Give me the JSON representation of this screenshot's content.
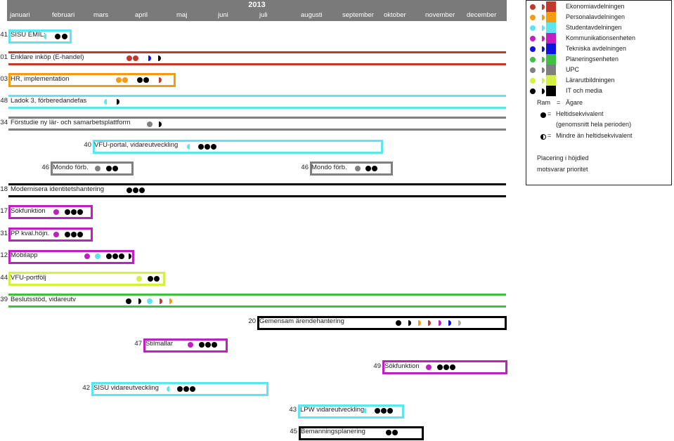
{
  "header": {
    "year": "2013",
    "months": [
      "januari",
      "februari",
      "mars",
      "april",
      "maj",
      "juni",
      "juli",
      "augusti",
      "september",
      "oktober",
      "november",
      "december"
    ]
  },
  "colors": {
    "ekonomi": "#c0392b",
    "personal": "#f39c12",
    "student": "#5ee6f0",
    "kommunikation": "#c020c0",
    "tekniska": "#1010e0",
    "planering": "#40c040",
    "upc": "#808080",
    "lararutb": "#d4f040",
    "it": "#000000"
  },
  "legend": {
    "units": [
      {
        "name": "Ekonomiavdelningen",
        "color_key": "ekonomi"
      },
      {
        "name": "Personalavdelningen",
        "color_key": "personal"
      },
      {
        "name": "Studentavdelningen",
        "color_key": "student"
      },
      {
        "name": "Kommunikationsenheten",
        "color_key": "kommunikation"
      },
      {
        "name": "Tekniska avdelningen",
        "color_key": "tekniska"
      },
      {
        "name": "Planeringsenheten",
        "color_key": "planering"
      },
      {
        "name": "UPC",
        "color_key": "upc"
      },
      {
        "name": "Lärarutbildningen",
        "color_key": "lararutb"
      },
      {
        "name": "IT och media",
        "color_key": "it"
      }
    ],
    "ram_label": "Ram",
    "eq": "=",
    "owner": "Ägare",
    "full_fte": "Heltidsekvivalent",
    "full_fte_note": "(genomsnitt hela perioden)",
    "less_fte": "Mindre än heltidsekvivalent",
    "placement_1": "Placering i höjdled",
    "placement_2": "motsvarar prioritet"
  },
  "projects": [
    {
      "num": "41",
      "label": "SISU EMIL:"
    },
    {
      "num": "01",
      "label": "Enklare inköp (E-handel)"
    },
    {
      "num": "03",
      "label": "HR, implementation"
    },
    {
      "num": "48",
      "label": "Ladok 3, förberedandefas"
    },
    {
      "num": "34",
      "label": "Förstudie ny lär- och samarbetsplattform"
    },
    {
      "num": "40",
      "label": "VFU-portal, vidareutveckling"
    },
    {
      "num": "46",
      "label": "Mondo förb."
    },
    {
      "num": "46",
      "label": "Mondo förb."
    },
    {
      "num": "18",
      "label": "Modernisera identitetshantering"
    },
    {
      "num": "17",
      "label": "Sökfunktion"
    },
    {
      "num": "31",
      "label": "PP kval.höjn."
    },
    {
      "num": "12",
      "label": "Mobilapp"
    },
    {
      "num": "44",
      "label": "VFU-portfölj"
    },
    {
      "num": "39",
      "label": "Beslutsstöd, vidareutv"
    },
    {
      "num": "20",
      "label": "Gemensam ärendehantering"
    },
    {
      "num": "47",
      "label": "Stilmallar"
    },
    {
      "num": "49",
      "label": "Sökfunktion"
    },
    {
      "num": "42",
      "label": "SISU vidareutveckling"
    },
    {
      "num": "43",
      "label": "LPW vidareutveckling"
    },
    {
      "num": "45",
      "label": "Bemanningsplanering"
    }
  ]
}
